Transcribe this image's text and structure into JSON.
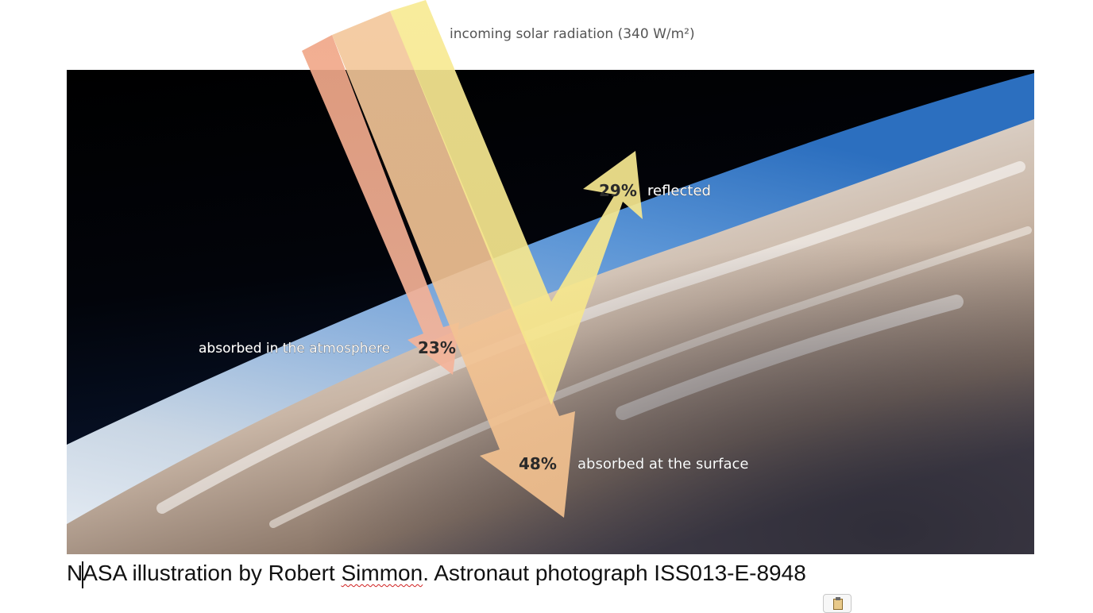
{
  "diagram": {
    "top_label": "incoming solar radiation (340 W/m²)",
    "reflected": {
      "percent": "29%",
      "label": "reflected"
    },
    "atmosphere": {
      "percent": "23%",
      "label": "absorbed in the atmosphere"
    },
    "surface": {
      "percent": "48%",
      "label": "absorbed at the surface"
    }
  },
  "caption": {
    "part1": "NASA illustration by Robert ",
    "misspelled": "Simmon",
    "part2": ". Astronaut photograph ISS013-E-8948"
  },
  "icons": {
    "paste": "paste-options-icon"
  }
}
